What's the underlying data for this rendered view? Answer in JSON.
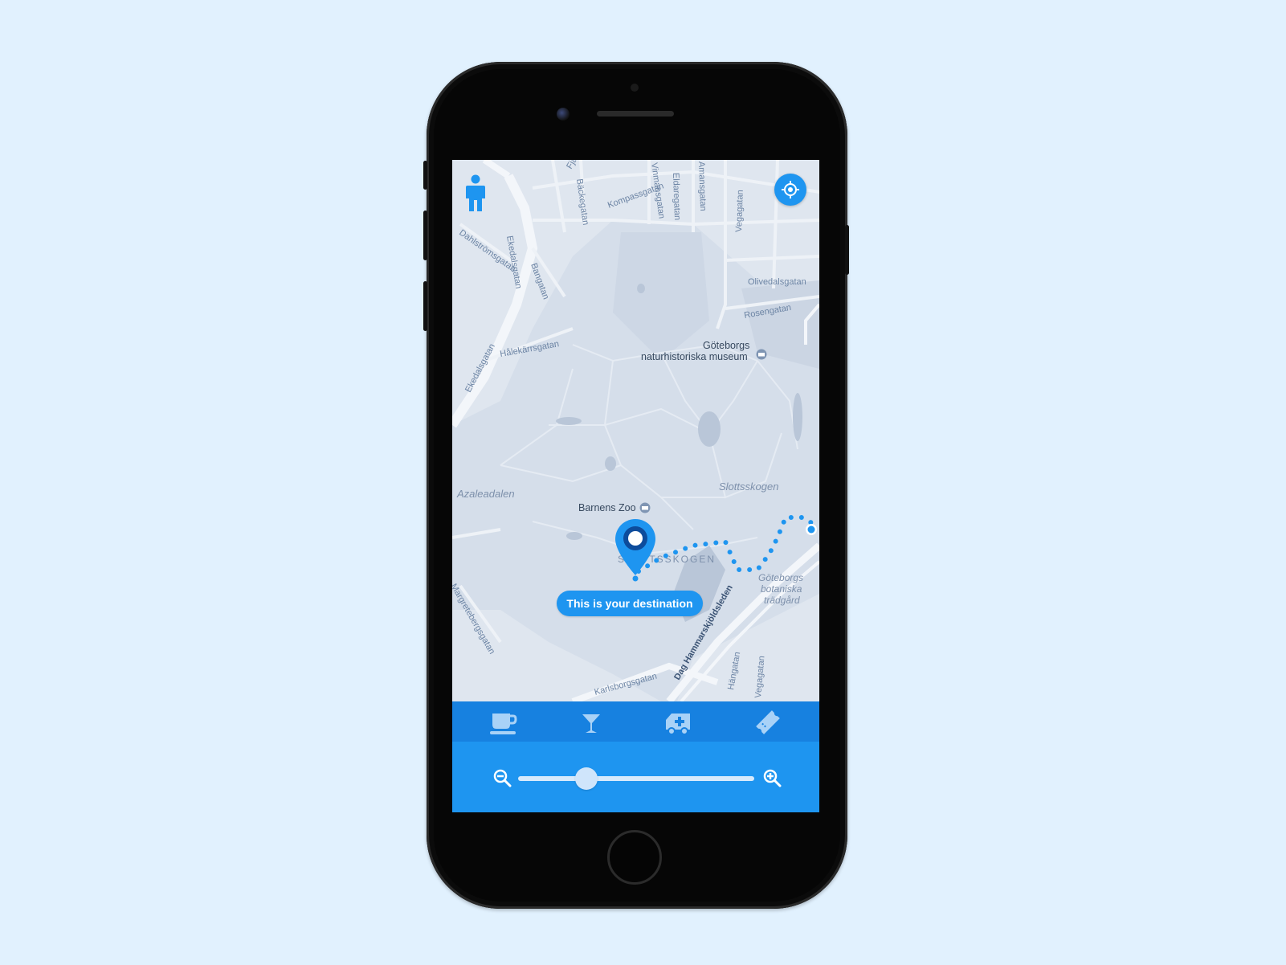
{
  "colors": {
    "page_background": "#e1f1fe",
    "accent": "#1e95f0",
    "category_bar": "#1781e0",
    "map_park": "#d5deea",
    "map_road": "#f3f6fa",
    "route": "#1e95f0"
  },
  "map": {
    "street_labels": [
      "Fjäll",
      "Bäckegatan",
      "Kompassgatan",
      "Vinmansgatan",
      "Eldaregatan",
      "Amansgatan",
      "Vegagatan",
      "Olivedalsgatan",
      "Rosengatan",
      "Dahlströmsgatan",
      "Ekedalsgatan",
      "Bangatan",
      "Hålekärrsgatan",
      "Ekedalsgatan",
      "Dag Hammarskjöldsleden",
      "Karlsborgsgatan",
      "Hängatan",
      "Vegagatan"
    ],
    "places": {
      "museum_line1": "Göteborgs",
      "museum_line2": "naturhistoriska museum",
      "zoo": "Barnens Zoo",
      "park_region": "SLOTTSSKOGEN",
      "park_area": "Slottsskogen",
      "azalea": "Azaleadalen",
      "garden_line1": "Göteborgs",
      "garden_line2": "botaniska",
      "garden_line3": "trädgård",
      "bottom_street": "Karlsborgsgatan",
      "left_street": "Margretebergsgatan"
    },
    "icons": {
      "user": "person-icon",
      "locate": "crosshair-icon",
      "destination": "map-pin-icon"
    },
    "destination_tooltip": "This is your destination"
  },
  "categories": [
    {
      "name": "coffee",
      "icon": "coffee-cup-icon"
    },
    {
      "name": "bar",
      "icon": "cocktail-glass-icon"
    },
    {
      "name": "hospital",
      "icon": "ambulance-icon"
    },
    {
      "name": "tickets",
      "icon": "ticket-icon"
    }
  ],
  "zoom": {
    "zoom_out_icon": "zoom-out-icon",
    "zoom_in_icon": "zoom-in-icon",
    "level": 0.29
  }
}
